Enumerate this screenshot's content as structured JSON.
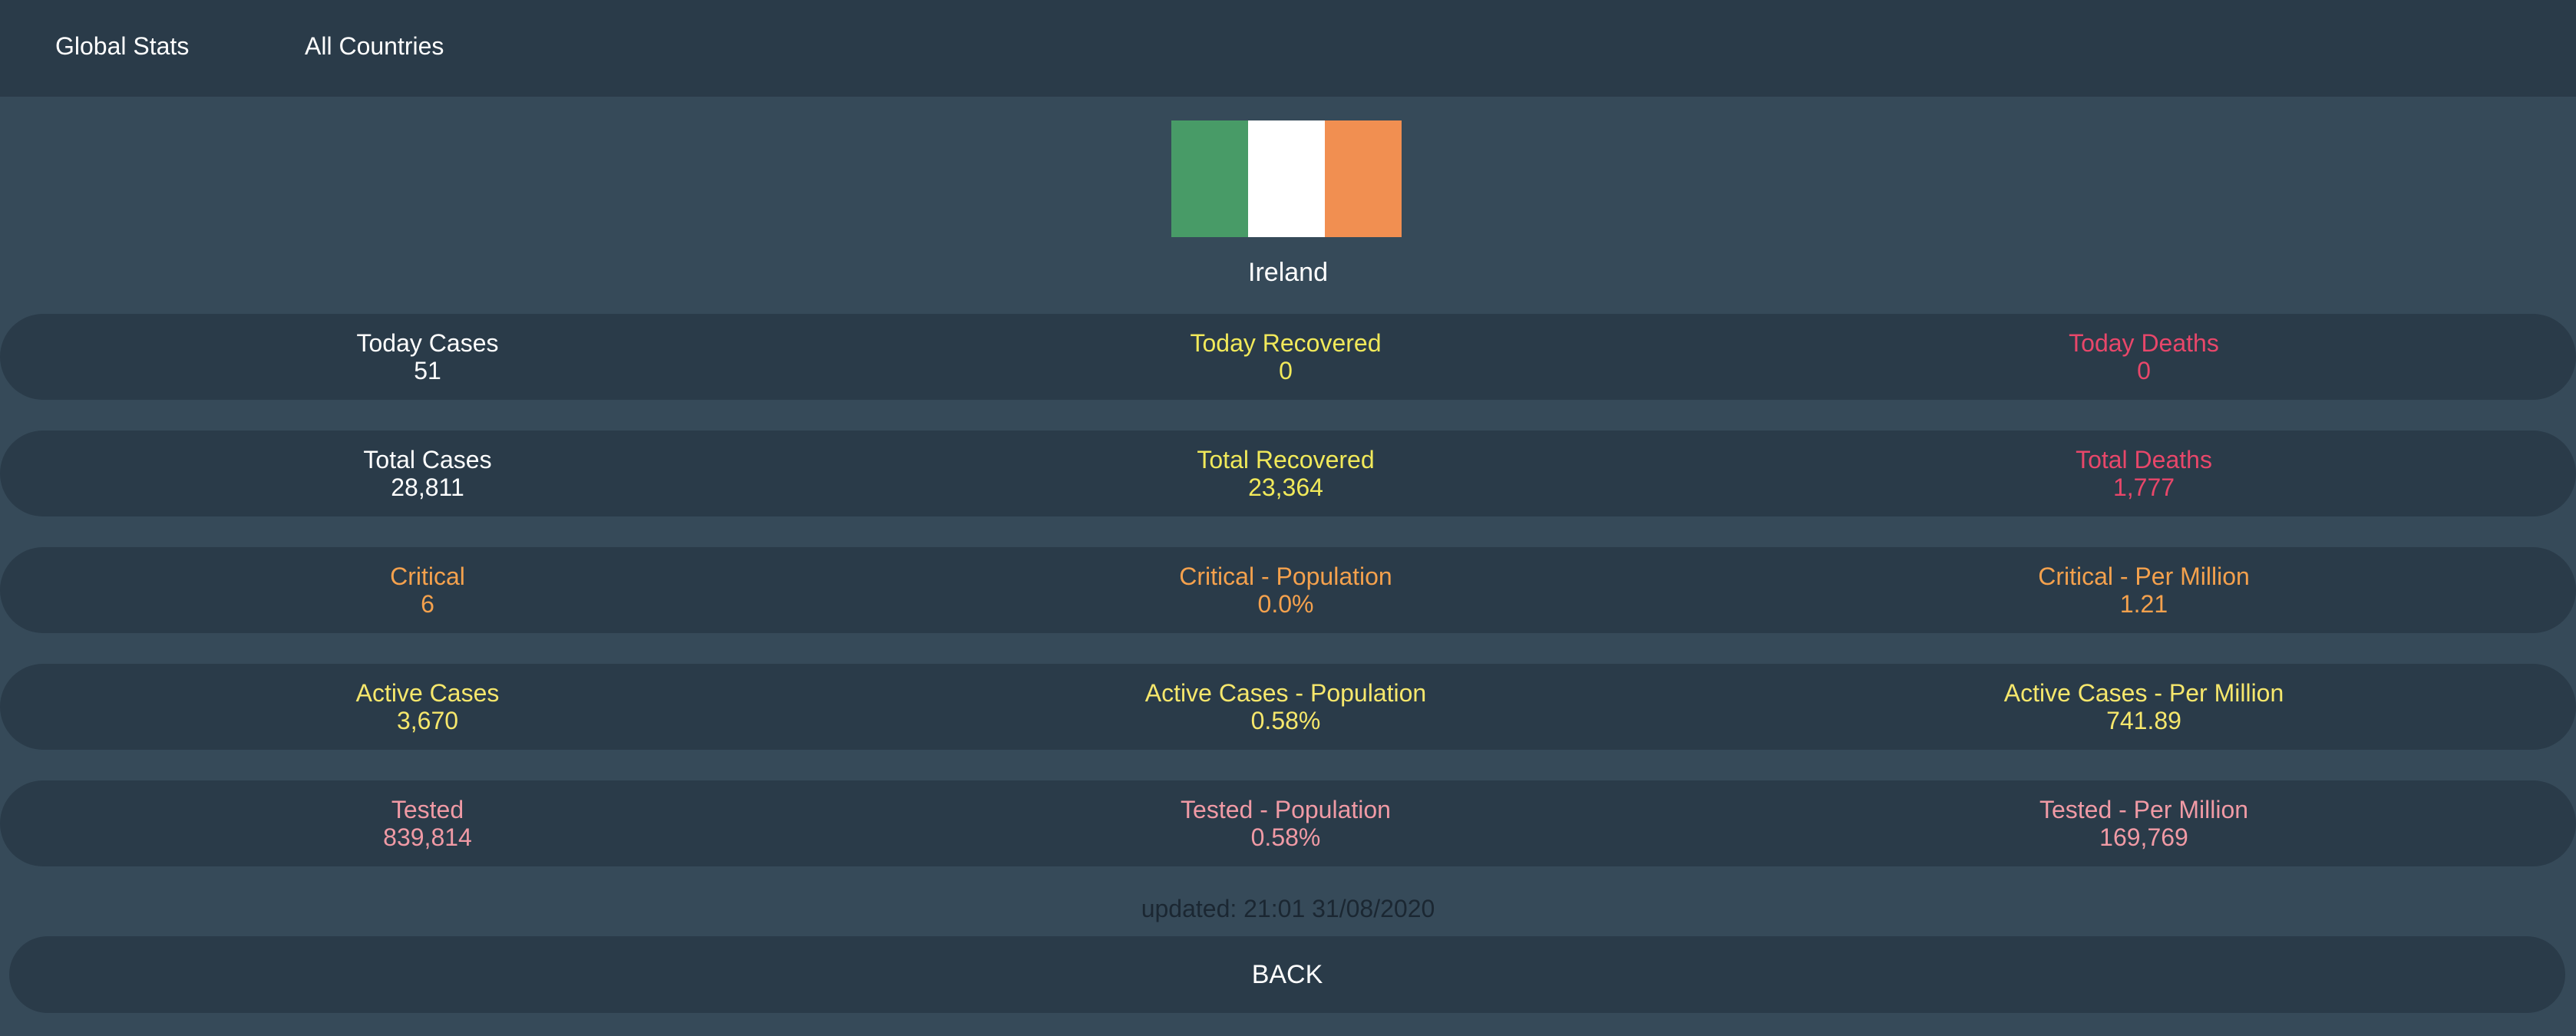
{
  "nav": {
    "global_stats": "Global Stats",
    "all_countries": "All Countries"
  },
  "country": {
    "name": "Ireland",
    "flag_colors": [
      "#489b67",
      "#ffffff",
      "#f18f51"
    ]
  },
  "colors": {
    "white": "#ffffff",
    "recovered": "#f1e95a",
    "deaths": "#e8476a",
    "critical": "#f4a14d",
    "active": "#f6e76c",
    "tested": "#f09aa5"
  },
  "rows": [
    {
      "color_key": "mixed",
      "cells": [
        {
          "label": "Today Cases",
          "value": "51"
        },
        {
          "label": "Today Recovered",
          "value": "0"
        },
        {
          "label": "Today Deaths",
          "value": "0"
        }
      ]
    },
    {
      "color_key": "mixed",
      "cells": [
        {
          "label": "Total Cases",
          "value": "28,811"
        },
        {
          "label": "Total Recovered",
          "value": "23,364"
        },
        {
          "label": "Total Deaths",
          "value": "1,777"
        }
      ]
    },
    {
      "color_key": "critical",
      "cells": [
        {
          "label": "Critical",
          "value": "6"
        },
        {
          "label": "Critical - Population",
          "value": "0.0%"
        },
        {
          "label": "Critical - Per Million",
          "value": "1.21"
        }
      ]
    },
    {
      "color_key": "active",
      "cells": [
        {
          "label": "Active Cases",
          "value": "3,670"
        },
        {
          "label": "Active Cases - Population",
          "value": "0.58%"
        },
        {
          "label": "Active Cases - Per Million",
          "value": "741.89"
        }
      ]
    },
    {
      "color_key": "tested",
      "cells": [
        {
          "label": "Tested",
          "value": "839,814"
        },
        {
          "label": "Tested - Population",
          "value": "0.58%"
        },
        {
          "label": "Tested - Per Million",
          "value": "169,769"
        }
      ]
    }
  ],
  "updated": "updated: 21:01 31/08/2020",
  "back_label": "BACK"
}
